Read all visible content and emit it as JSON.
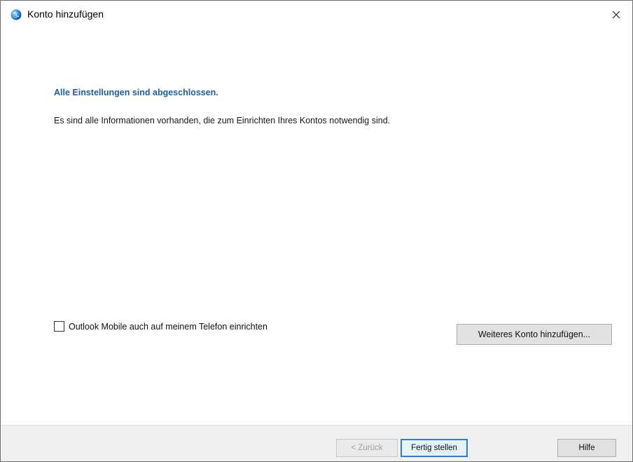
{
  "window": {
    "title": "Konto hinzufügen",
    "icon": "outlook-globe-icon",
    "close_glyph": "✕"
  },
  "content": {
    "heading": "Alle Einstellungen sind abgeschlossen.",
    "description": "Es sind alle Informationen vorhanden, die zum Einrichten Ihres Kontos notwendig sind.",
    "checkbox": {
      "label": "Outlook Mobile auch auf meinem Telefon einrichten",
      "checked": false
    },
    "add_account_button": "Weiteres Konto hinzufügen..."
  },
  "footer": {
    "back_button": "< Zurück",
    "finish_button": "Fertig stellen",
    "help_button": "Hilfe"
  },
  "colors": {
    "heading": "#1f5da8",
    "default_button_border": "#2d7bd4",
    "footer_bg": "#f0f0f0"
  }
}
